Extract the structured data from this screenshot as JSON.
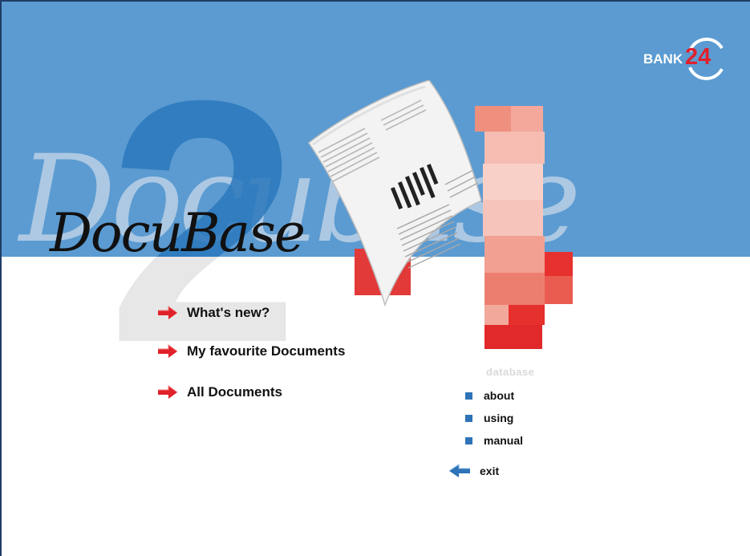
{
  "brand": {
    "logo_prefix": "BANK",
    "logo_number": "24",
    "title": "DocuBase",
    "database_label": "database"
  },
  "menu": {
    "items": [
      {
        "label": "What's new?",
        "icon": "right-arrow-icon"
      },
      {
        "label": "My favourite Documents",
        "icon": "right-arrow-icon"
      },
      {
        "label": "All Documents",
        "icon": "right-arrow-icon"
      }
    ]
  },
  "database_menu": {
    "items": [
      {
        "label": "about",
        "icon": "square-bullet-icon"
      },
      {
        "label": "using",
        "icon": "square-bullet-icon"
      },
      {
        "label": "manual",
        "icon": "square-bullet-icon"
      }
    ],
    "exit_label": "exit",
    "exit_icon": "left-arrow-icon"
  },
  "colors": {
    "banner_blue": "#5b9bd1",
    "accent_red": "#e0202a",
    "bullet_blue": "#2e73b8"
  }
}
